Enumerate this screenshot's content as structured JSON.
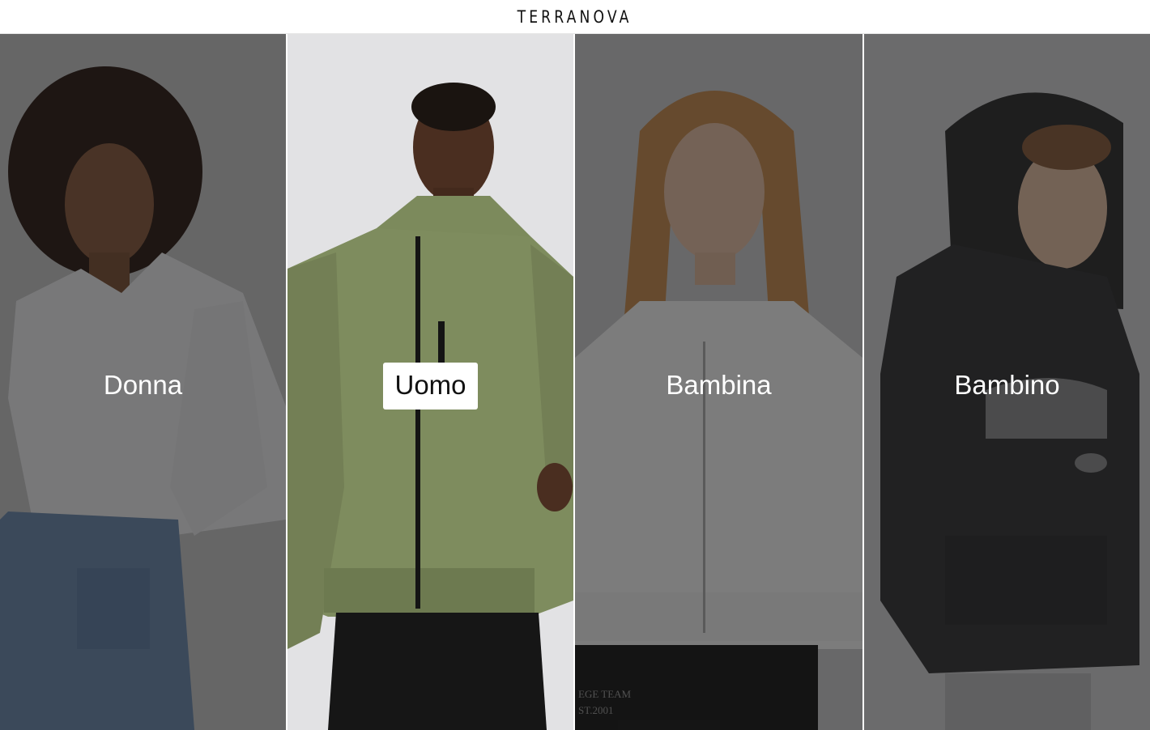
{
  "brand": {
    "logo_text": "TERRANOVA"
  },
  "categories": [
    {
      "label": "Donna",
      "active": false
    },
    {
      "label": "Uomo",
      "active": true
    },
    {
      "label": "Bambina",
      "active": false
    },
    {
      "label": "Bambino",
      "active": false
    }
  ],
  "colors": {
    "overlay": "#141414",
    "active_label_bg": "#ffffff",
    "label_text": "#ffffff"
  }
}
